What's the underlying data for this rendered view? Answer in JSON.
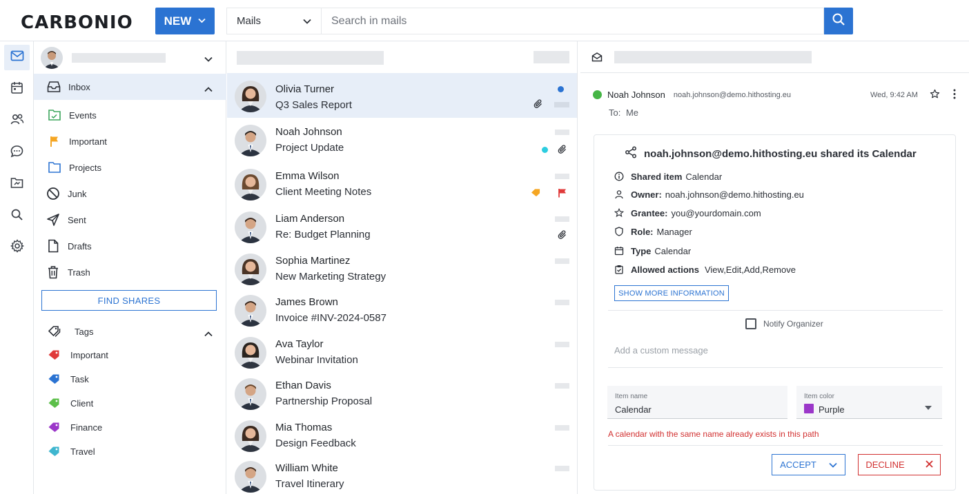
{
  "app": {
    "logo": "CARBONIO",
    "accent": "#2b73d2"
  },
  "topbar": {
    "new_label": "NEW",
    "module_label": "Mails",
    "search_placeholder": "Search in mails"
  },
  "rail": [
    "mail-icon",
    "calendar-icon",
    "contacts-icon",
    "chat-icon",
    "files-icon",
    "search-icon",
    "settings-icon"
  ],
  "folders": [
    {
      "label": "Inbox",
      "icon": "inbox-icon"
    },
    {
      "label": "Events",
      "icon": "folder-icon",
      "color": "#3ba55c"
    },
    {
      "label": "Important",
      "icon": "flag-icon",
      "color": "#f5a623"
    },
    {
      "label": "Projects",
      "icon": "folder-icon",
      "color": "#2b73d2"
    },
    {
      "label": "Junk",
      "icon": "block-icon"
    },
    {
      "label": "Sent",
      "icon": "send-icon"
    },
    {
      "label": "Drafts",
      "icon": "draft-icon"
    },
    {
      "label": "Trash",
      "icon": "trash-icon"
    }
  ],
  "find_shares_label": "FIND SHARES",
  "tags": {
    "header": "Tags",
    "items": [
      {
        "label": "Important",
        "color": "#e03a3a"
      },
      {
        "label": "Task",
        "color": "#2b73d2"
      },
      {
        "label": "Client",
        "color": "#5cbf4a"
      },
      {
        "label": "Finance",
        "color": "#9b37c9"
      },
      {
        "label": "Travel",
        "color": "#3fb6cf"
      }
    ]
  },
  "messages": [
    {
      "name": "Olivia Turner",
      "subject": "Q3 Sales Report"
    },
    {
      "name": "Noah Johnson",
      "subject": "Project Update"
    },
    {
      "name": "Emma Wilson",
      "subject": "Client Meeting Notes"
    },
    {
      "name": "Liam Anderson",
      "subject": "Re: Budget Planning"
    },
    {
      "name": "Sophia Martinez",
      "subject": "New Marketing Strategy"
    },
    {
      "name": "James Brown",
      "subject": "Invoice #INV-2024-0587"
    },
    {
      "name": "Ava Taylor",
      "subject": "Webinar Invitation"
    },
    {
      "name": "Ethan Davis",
      "subject": "Partnership Proposal"
    },
    {
      "name": "Mia Thomas",
      "subject": "Design Feedback"
    },
    {
      "name": "William White",
      "subject": "Travel Itinerary"
    }
  ],
  "reader": {
    "sender_name": "Noah Johnson",
    "sender_email": "noah.johnson@demo.hithosting.eu",
    "time": "Wed, 9:42 AM",
    "to_label": "To:",
    "to_value": "Me",
    "share": {
      "title": "noah.johnson@demo.hithosting.eu shared its Calendar",
      "shared_item_label": "Shared item",
      "shared_item_value": "Calendar",
      "owner_label": "Owner:",
      "owner_value": "noah.johnson@demo.hithosting.eu",
      "grantee_label": "Grantee:",
      "grantee_value": "you@yourdomain.com",
      "role_label": "Role:",
      "role_value": "Manager",
      "type_label": "Type",
      "type_value": "Calendar",
      "actions_label": "Allowed actions",
      "actions_value": "View,Edit,Add,Remove",
      "more_info_label": "SHOW MORE INFORMATION",
      "notify_label": "Notify Organizer",
      "custom_message_placeholder": "Add a custom message",
      "item_name_label": "Item name",
      "item_name_value": "Calendar",
      "item_color_label": "Item color",
      "item_color_value": "Purple",
      "item_color_hex": "#9b37c9",
      "error": "A calendar with the same name already exists in this path",
      "accept_label": "ACCEPT",
      "decline_label": "DECLINE"
    }
  }
}
